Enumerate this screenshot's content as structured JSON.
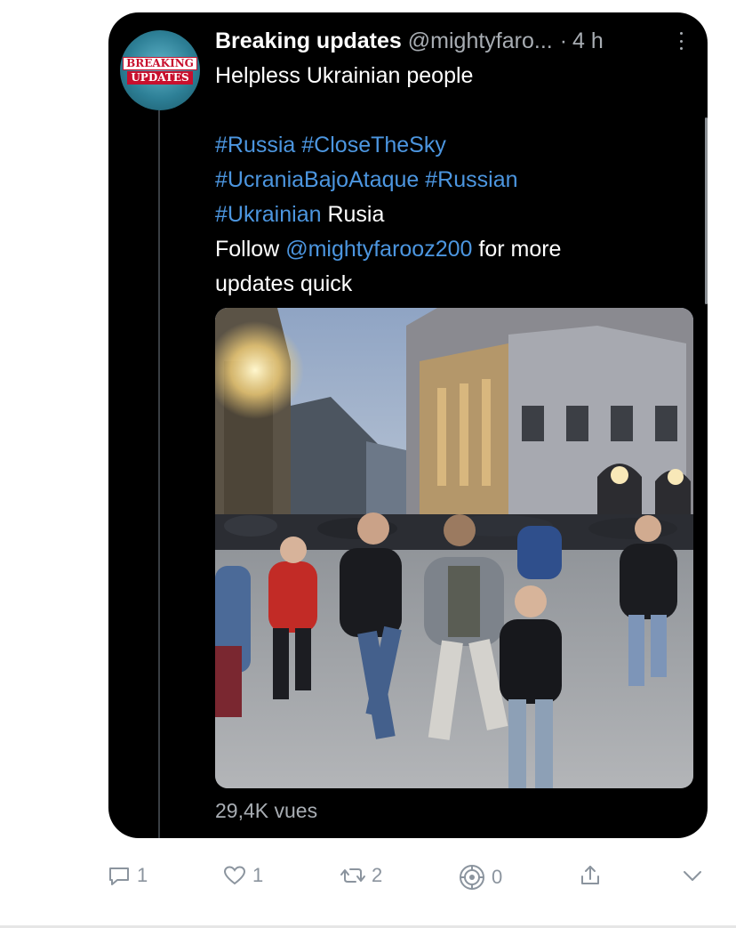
{
  "account": {
    "avatar_text_line1": "BREAKING",
    "avatar_text_line2": "UPDATES",
    "display_name": "Breaking updates",
    "handle": "@mightyfaro...",
    "separator": "·",
    "time": "4 h"
  },
  "tweet": {
    "line1": "Helpless Ukrainian people",
    "tags_line1": [
      "#Russia",
      "#CloseTheSky"
    ],
    "tags_line2": [
      "#UcraniaBajoAtaque",
      "#Russian"
    ],
    "tag_line3": "#Ukrainian",
    "word_line3": "Rusia",
    "follow_word": "Follow",
    "follow_mention": "@mightyfarooz200",
    "follow_rest": "for more",
    "last_line": "updates quick"
  },
  "media": {
    "kind": "video-thumbnail",
    "description_icon": "video-frame"
  },
  "stats": {
    "views": "29,4K vues"
  },
  "actions": {
    "reply_count": "1",
    "like_count": "1",
    "retweet_count": "2",
    "analytics_count": "0"
  },
  "colors": {
    "card_bg": "#000000",
    "text": "#ffffff",
    "secondary": "#a8adb3",
    "link": "#4c96e0",
    "action_gray": "#8b949e",
    "badge_red": "#c8102e"
  }
}
